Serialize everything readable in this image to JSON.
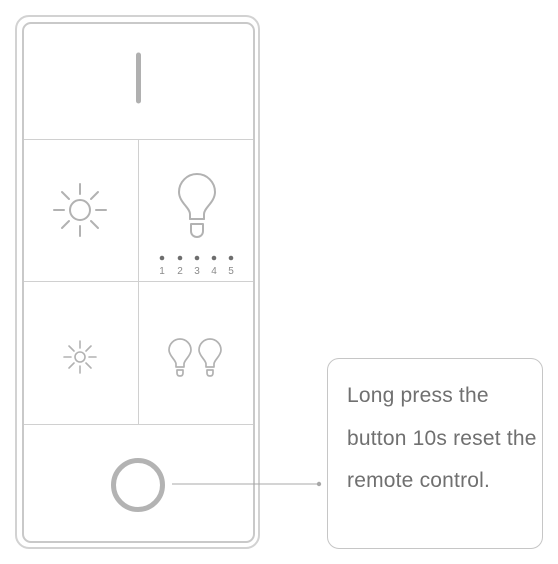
{
  "remote": {
    "top_icon": "power-switch-bar-icon",
    "buttons": [
      {
        "name": "brightness-up",
        "icon": "large-sun-icon"
      },
      {
        "name": "single-bulb",
        "icon": "lightbulb-icon",
        "level_dots": [
          "1",
          "2",
          "3",
          "4",
          "5"
        ]
      },
      {
        "name": "brightness-down",
        "icon": "small-sun-icon"
      },
      {
        "name": "double-bulb",
        "icon": "two-lightbulbs-icon"
      },
      {
        "name": "reset",
        "icon": "ring-button-icon"
      }
    ]
  },
  "callout": {
    "text": "Long press the button 10s reset the remote control."
  },
  "colors": {
    "icon": "#b2b2b2",
    "outline": "#c9c9c9",
    "text": "#707070"
  }
}
